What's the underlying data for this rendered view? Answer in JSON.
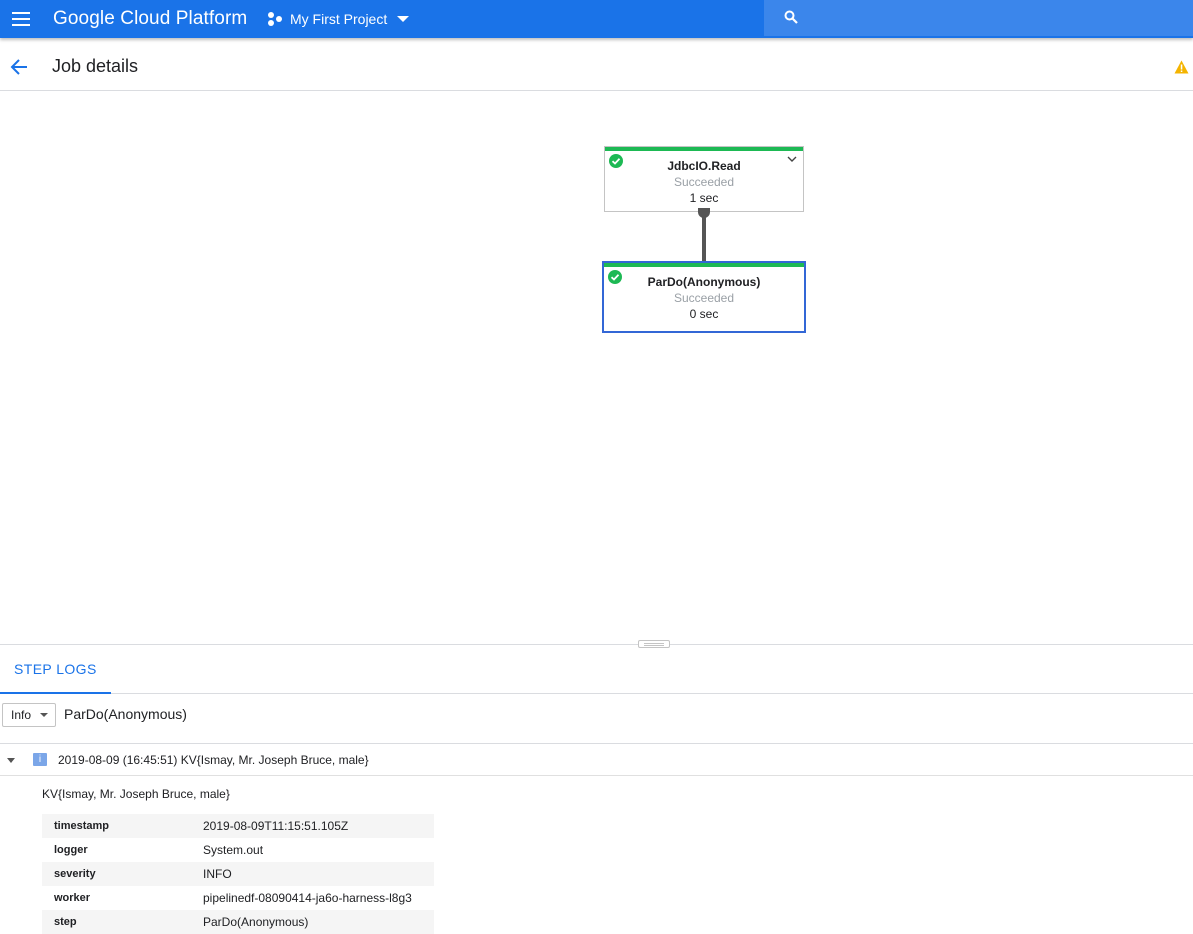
{
  "appbar": {
    "product_name": "Google Cloud Platform",
    "project_name": "My First Project",
    "search_placeholder": "",
    "colors": {
      "bar": "#1a73e8",
      "search": "#3b86eb"
    }
  },
  "header": {
    "title": "Job details"
  },
  "graph": {
    "nodes": [
      {
        "name": "JdbcIO.Read",
        "status": "Succeeded",
        "duration": "1 sec",
        "selected": false
      },
      {
        "name": "ParDo(Anonymous)",
        "status": "Succeeded",
        "duration": "0 sec",
        "selected": true
      }
    ],
    "colors": {
      "success": "#1db954",
      "selected_border": "#3367d6"
    }
  },
  "tabs": [
    {
      "label": "STEP LOGS",
      "active": true
    }
  ],
  "filter": {
    "severity": "Info",
    "step": "ParDo(Anonymous)"
  },
  "log_entry": {
    "badge": "i",
    "summary": "2019-08-09 (16:45:51) KV{Ismay, Mr. Joseph Bruce, male}",
    "message": "KV{Ismay, Mr. Joseph Bruce, male}",
    "fields": [
      {
        "key": "timestamp",
        "value": "2019-08-09T11:15:51.105Z"
      },
      {
        "key": "logger",
        "value": "System.out"
      },
      {
        "key": "severity",
        "value": "INFO"
      },
      {
        "key": "worker",
        "value": "pipelinedf-08090414-ja6o-harness-l8g3"
      },
      {
        "key": "step",
        "value": "ParDo(Anonymous)"
      }
    ]
  }
}
